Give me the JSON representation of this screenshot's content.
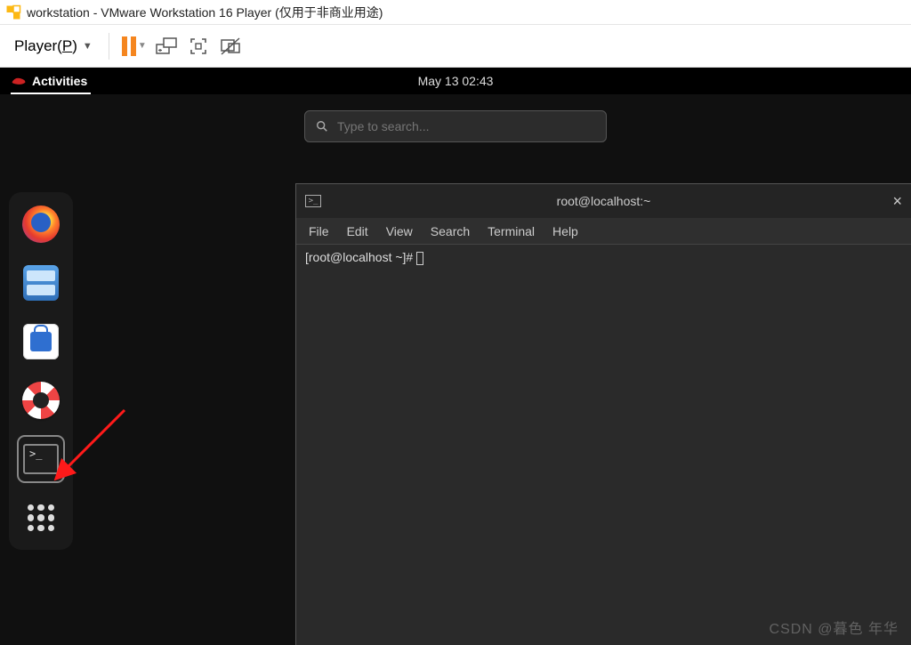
{
  "vmware": {
    "title": "workstation - VMware Workstation 16 Player (仅用于非商业用途)",
    "player_menu": "Player(P)"
  },
  "gnome": {
    "activities": "Activities",
    "clock": "May 13  02:43",
    "search_placeholder": "Type to search..."
  },
  "dock": {
    "items": [
      "firefox",
      "files",
      "software",
      "help",
      "terminal",
      "apps"
    ]
  },
  "terminal": {
    "title": "root@localhost:~",
    "menu": {
      "file": "File",
      "edit": "Edit",
      "view": "View",
      "search": "Search",
      "terminal": "Terminal",
      "help": "Help"
    },
    "prompt": "[root@localhost ~]# "
  },
  "watermark": "CSDN @暮色  年华"
}
